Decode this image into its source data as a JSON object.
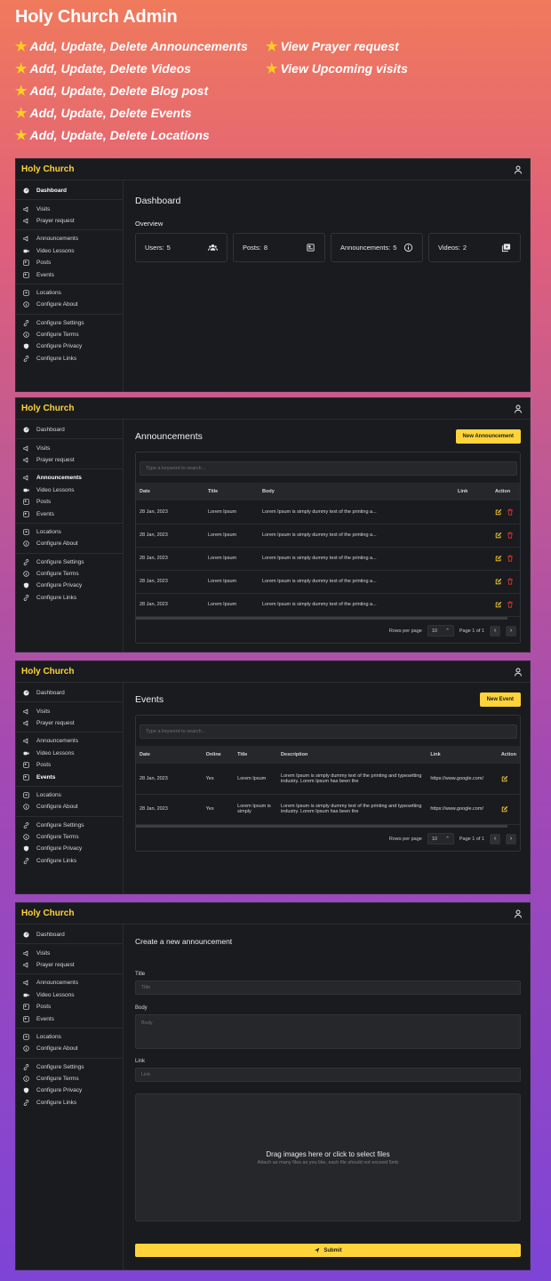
{
  "hero": {
    "title": "Holy Church Admin",
    "features_left": [
      "Add, Update, Delete Announcements",
      "Add, Update, Delete Videos",
      "Add, Update, Delete Blog post",
      "Add, Update, Delete Events",
      "Add, Update, Delete Locations"
    ],
    "features_right": [
      "View Prayer request",
      "View Upcoming visits"
    ]
  },
  "brand": "Holy Church",
  "sidebar": {
    "groups": [
      [
        {
          "label": "Dashboard",
          "icon": "gauge-icon"
        }
      ],
      [
        {
          "label": "Visits",
          "icon": "megaphone-icon"
        },
        {
          "label": "Prayer request",
          "icon": "megaphone-icon"
        }
      ],
      [
        {
          "label": "Announcements",
          "icon": "megaphone-icon"
        },
        {
          "label": "Video Lessons",
          "icon": "video-icon"
        },
        {
          "label": "Posts",
          "icon": "news-icon"
        },
        {
          "label": "Events",
          "icon": "news-icon"
        }
      ],
      [
        {
          "label": "Locations",
          "icon": "map-icon"
        },
        {
          "label": "Configure About",
          "icon": "info-icon"
        }
      ],
      [
        {
          "label": "Configure Settings",
          "icon": "link-icon"
        },
        {
          "label": "Configure Terms",
          "icon": "info-icon"
        },
        {
          "label": "Configure Privacy",
          "icon": "shield-icon"
        },
        {
          "label": "Configure Links",
          "icon": "link-icon"
        }
      ]
    ]
  },
  "dashboard": {
    "title": "Dashboard",
    "overview": "Overview",
    "cards": [
      {
        "label": "Users:",
        "value": "5",
        "icon": "users-icon"
      },
      {
        "label": "Posts:",
        "value": "8",
        "icon": "posts-icon"
      },
      {
        "label": "Announcements:",
        "value": "5",
        "icon": "info-icon"
      },
      {
        "label": "Videos:",
        "value": "2",
        "icon": "videos-icon"
      }
    ]
  },
  "announcements": {
    "title": "Announcements",
    "new_button": "New Announcement",
    "search_placeholder": "Type a keyword to search...",
    "columns": [
      "Date",
      "Title",
      "Body",
      "Link",
      "Action"
    ],
    "rows": [
      [
        "28 Jan, 2023",
        "Lorem Ipsum",
        "Lorem Ipsum is simply dummy text of the printing a...",
        ""
      ],
      [
        "28 Jan, 2023",
        "Lorem Ipsum",
        "Lorem Ipsum is simply dummy text of the printing a...",
        ""
      ],
      [
        "28 Jan, 2023",
        "Lorem Ipsum",
        "Lorem Ipsum is simply dummy text of the printing a...",
        ""
      ],
      [
        "28 Jan, 2023",
        "Lorem Ipsum",
        "Lorem Ipsum is simply dummy text of the printing a...",
        ""
      ],
      [
        "28 Jan, 2023",
        "Lorem Ipsum",
        "Lorem Ipsum is simply dummy text of the printing a...",
        ""
      ]
    ],
    "rows_per_page_label": "Rows per page",
    "rows_per_page": "10",
    "page_info": "Page 1 of 1"
  },
  "events": {
    "title": "Events",
    "new_button": "New Event",
    "search_placeholder": "Type a keyword to search...",
    "columns": [
      "Date",
      "Online",
      "Title",
      "Description",
      "Link",
      "Action"
    ],
    "rows": [
      [
        "28 Jan, 2023",
        "Yes",
        "Lorem Ipsum",
        "Lorem Ipsum is simply dummy text of the printing and typesetting industry. Lorem Ipsum has been the",
        "https://www.google.com/"
      ],
      [
        "28 Jan, 2023",
        "Yes",
        "Lorem Ipsum is simply",
        "Lorem Ipsum is simply dummy text of the printing and typesetting industry. Lorem Ipsum has been the",
        "https://www.google.com/"
      ]
    ],
    "rows_per_page_label": "Rows per page",
    "rows_per_page": "10",
    "page_info": "Page 1 of 1"
  },
  "create": {
    "title": "Create a new announcement",
    "title_label": "Title",
    "title_placeholder": "Title",
    "body_label": "Body",
    "body_placeholder": "Body",
    "link_label": "Link",
    "link_placeholder": "Link",
    "drop_title": "Drag images here or click to select files",
    "drop_sub": "Attach as many files as you like, each file should not exceed 5mb",
    "submit": "Submit"
  },
  "colors": {
    "accent": "#ffd43b",
    "panel": "#1a1b1e",
    "delete": "#e03131"
  }
}
